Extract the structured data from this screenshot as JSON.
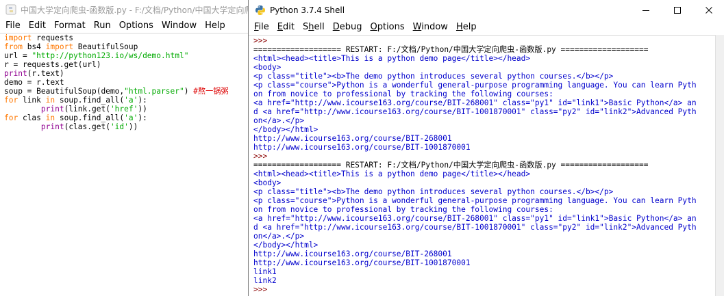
{
  "editor": {
    "title": "中国大学定向爬虫-函数版.py - F:/文档/Python/中国大学定向爬",
    "menu": [
      "File",
      "Edit",
      "Format",
      "Run",
      "Options",
      "Window",
      "Help"
    ],
    "code_lines": [
      [
        {
          "t": "import",
          "c": "kw"
        },
        {
          "t": " requests",
          "c": "plain"
        }
      ],
      [
        {
          "t": "from",
          "c": "kw"
        },
        {
          "t": " bs4 ",
          "c": "plain"
        },
        {
          "t": "import",
          "c": "kw"
        },
        {
          "t": " BeautifulSoup",
          "c": "plain"
        }
      ],
      [
        {
          "t": "url = ",
          "c": "plain"
        },
        {
          "t": "\"http://python123.io/ws/demo.html\"",
          "c": "str"
        }
      ],
      [
        {
          "t": "r = requests.get(url)",
          "c": "plain"
        }
      ],
      [
        {
          "t": "print",
          "c": "builtin"
        },
        {
          "t": "(r.text)",
          "c": "plain"
        }
      ],
      [
        {
          "t": "demo = r.text",
          "c": "plain"
        }
      ],
      [
        {
          "t": "soup = BeautifulSoup(demo,",
          "c": "plain"
        },
        {
          "t": "\"html.parser\"",
          "c": "str"
        },
        {
          "t": ") ",
          "c": "plain"
        },
        {
          "t": "#熬一锅粥",
          "c": "comment"
        }
      ],
      [
        {
          "t": "for",
          "c": "kw"
        },
        {
          "t": " link ",
          "c": "plain"
        },
        {
          "t": "in",
          "c": "kw"
        },
        {
          "t": " soup.find_all(",
          "c": "plain"
        },
        {
          "t": "'a'",
          "c": "str"
        },
        {
          "t": "):",
          "c": "plain"
        }
      ],
      [
        {
          "t": "        ",
          "c": "plain"
        },
        {
          "t": "print",
          "c": "builtin"
        },
        {
          "t": "(link.get(",
          "c": "plain"
        },
        {
          "t": "'href'",
          "c": "str"
        },
        {
          "t": "))",
          "c": "plain"
        }
      ],
      [
        {
          "t": "for",
          "c": "kw"
        },
        {
          "t": " clas ",
          "c": "plain"
        },
        {
          "t": "in",
          "c": "kw"
        },
        {
          "t": " soup.find_all(",
          "c": "plain"
        },
        {
          "t": "'a'",
          "c": "str"
        },
        {
          "t": "):",
          "c": "plain"
        }
      ],
      [
        {
          "t": "        ",
          "c": "plain"
        },
        {
          "t": "print",
          "c": "builtin"
        },
        {
          "t": "(clas.get(",
          "c": "plain"
        },
        {
          "t": "'id'",
          "c": "str"
        },
        {
          "t": "))",
          "c": "plain"
        }
      ]
    ]
  },
  "shell": {
    "title": "Python 3.7.4 Shell",
    "menu": [
      {
        "label": "File",
        "u": 0
      },
      {
        "label": "Edit",
        "u": 0
      },
      {
        "label": "Shell",
        "u": 1
      },
      {
        "label": "Debug",
        "u": 0
      },
      {
        "label": "Options",
        "u": 0
      },
      {
        "label": "Window",
        "u": 0
      },
      {
        "label": "Help",
        "u": 0
      }
    ],
    "window_controls": [
      "minimize-icon",
      "maximize-icon",
      "close-icon"
    ],
    "output_lines": [
      {
        "t": ">>>",
        "k": "prompt"
      },
      {
        "t": "=================== RESTART: F:/文档/Python/中国大学定向爬虫-函数版.py ===================",
        "k": "restart"
      },
      {
        "t": "<html><head><title>This is a python demo page</title></head>",
        "k": "stdout"
      },
      {
        "t": "<body>",
        "k": "stdout"
      },
      {
        "t": "<p class=\"title\"><b>The demo python introduces several python courses.</b></p>",
        "k": "stdout"
      },
      {
        "t": "<p class=\"course\">Python is a wonderful general-purpose programming language. You can learn Pyth",
        "k": "stdout"
      },
      {
        "t": "on from novice to professional by tracking the following courses:",
        "k": "stdout"
      },
      {
        "t": "<a href=\"http://www.icourse163.org/course/BIT-268001\" class=\"py1\" id=\"link1\">Basic Python</a> an",
        "k": "stdout"
      },
      {
        "t": "d <a href=\"http://www.icourse163.org/course/BIT-1001870001\" class=\"py2\" id=\"link2\">Advanced Pyth",
        "k": "stdout"
      },
      {
        "t": "on</a>.</p>",
        "k": "stdout"
      },
      {
        "t": "</body></html>",
        "k": "stdout"
      },
      {
        "t": "http://www.icourse163.org/course/BIT-268001",
        "k": "stdout"
      },
      {
        "t": "http://www.icourse163.org/course/BIT-1001870001",
        "k": "stdout"
      },
      {
        "t": ">>>",
        "k": "prompt"
      },
      {
        "t": "=================== RESTART: F:/文档/Python/中国大学定向爬虫-函数版.py ===================",
        "k": "restart"
      },
      {
        "t": "<html><head><title>This is a python demo page</title></head>",
        "k": "stdout"
      },
      {
        "t": "<body>",
        "k": "stdout"
      },
      {
        "t": "<p class=\"title\"><b>The demo python introduces several python courses.</b></p>",
        "k": "stdout"
      },
      {
        "t": "<p class=\"course\">Python is a wonderful general-purpose programming language. You can learn Pyth",
        "k": "stdout"
      },
      {
        "t": "on from novice to professional by tracking the following courses:",
        "k": "stdout"
      },
      {
        "t": "<a href=\"http://www.icourse163.org/course/BIT-268001\" class=\"py1\" id=\"link1\">Basic Python</a> an",
        "k": "stdout"
      },
      {
        "t": "d <a href=\"http://www.icourse163.org/course/BIT-1001870001\" class=\"py2\" id=\"link2\">Advanced Pyth",
        "k": "stdout"
      },
      {
        "t": "on</a>.</p>",
        "k": "stdout"
      },
      {
        "t": "</body></html>",
        "k": "stdout"
      },
      {
        "t": "http://www.icourse163.org/course/BIT-268001",
        "k": "stdout"
      },
      {
        "t": "http://www.icourse163.org/course/BIT-1001870001",
        "k": "stdout"
      },
      {
        "t": "link1",
        "k": "stdout"
      },
      {
        "t": "link2",
        "k": "stdout"
      },
      {
        "t": ">>>",
        "k": "prompt"
      }
    ]
  },
  "colors": {
    "keyword": "#ff7700",
    "string": "#00aa00",
    "builtin": "#900090",
    "comment": "#dd0000",
    "stdout": "#0000cc",
    "prompt": "#8b0000"
  }
}
